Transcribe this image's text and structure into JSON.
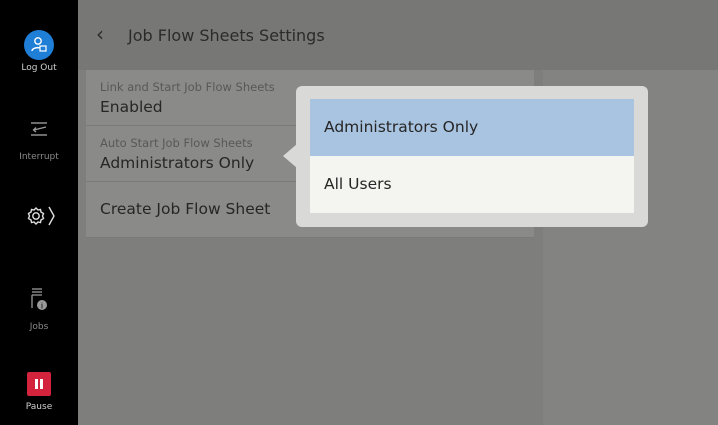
{
  "sidebar": {
    "logout_label": "Log Out",
    "interrupt_label": "Interrupt",
    "jobs_label": "Jobs",
    "pause_label": "Pause"
  },
  "header": {
    "title": "Job Flow Sheets Settings"
  },
  "settings": [
    {
      "label": "Link and Start Job Flow Sheets",
      "value": "Enabled"
    },
    {
      "label": "Auto Start Job Flow Sheets",
      "value": "Administrators Only"
    },
    {
      "label": "Create Job Flow Sheet"
    }
  ],
  "popup": {
    "options": [
      {
        "label": "Administrators Only",
        "selected": true
      },
      {
        "label": "All Users",
        "selected": false
      }
    ]
  },
  "colors": {
    "accent": "#1f7fd6",
    "selected": "#a9c4e0",
    "pause": "#d3233d"
  }
}
